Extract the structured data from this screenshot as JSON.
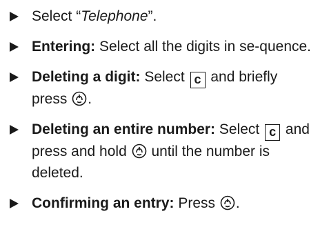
{
  "instructions": [
    {
      "pre": "Select “",
      "italic": "Telephone",
      "post": "”."
    },
    {
      "heading": "Entering:",
      "text": " Select all the digits in se-quence."
    },
    {
      "heading": "Deleting a digit:",
      "text_a": " Select ",
      "key": "c",
      "text_b": " and briefly press ",
      "text_c": "."
    },
    {
      "heading": "Deleting an entire number:",
      "text_a": " Select ",
      "key": "c",
      "text_b": " and press and hold ",
      "text_c": " until the number is deleted."
    },
    {
      "heading": "Confirming an entry:",
      "text_a": " Press ",
      "text_b": "."
    }
  ],
  "icons": {
    "bullet": "triangle-bullet-icon",
    "controller": "controller-knob-icon"
  }
}
